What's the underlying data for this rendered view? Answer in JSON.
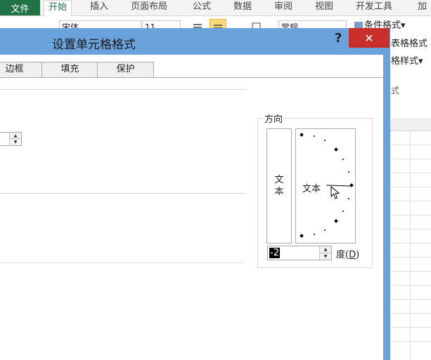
{
  "ribbon": {
    "file_tab": "文件",
    "tabs": [
      "开始",
      "插入",
      "页面布局",
      "公式",
      "数据",
      "审阅",
      "视图",
      "开发工具",
      "加"
    ],
    "font_name": "宋体",
    "font_size": "11",
    "number_format": "常规",
    "commands": [
      "条件格式",
      "表格格式",
      "格样式"
    ],
    "dropdown_glyph": "▾",
    "group_label": "式"
  },
  "dialog": {
    "title": "设置单元格格式",
    "help": "?",
    "close": "✕",
    "tabs": [
      "边框",
      "填充",
      "保护"
    ],
    "orientation": {
      "legend": "方向",
      "vertical_text": "文\n本",
      "dial_text": "文本",
      "degrees_value": "-2",
      "degrees_label": "度(",
      "degrees_accel": "D",
      "degrees_close": ")"
    }
  },
  "colors": {
    "excel_green": "#217346",
    "dialog_frame": "#6aa3db",
    "close_red": "#c9302c"
  }
}
